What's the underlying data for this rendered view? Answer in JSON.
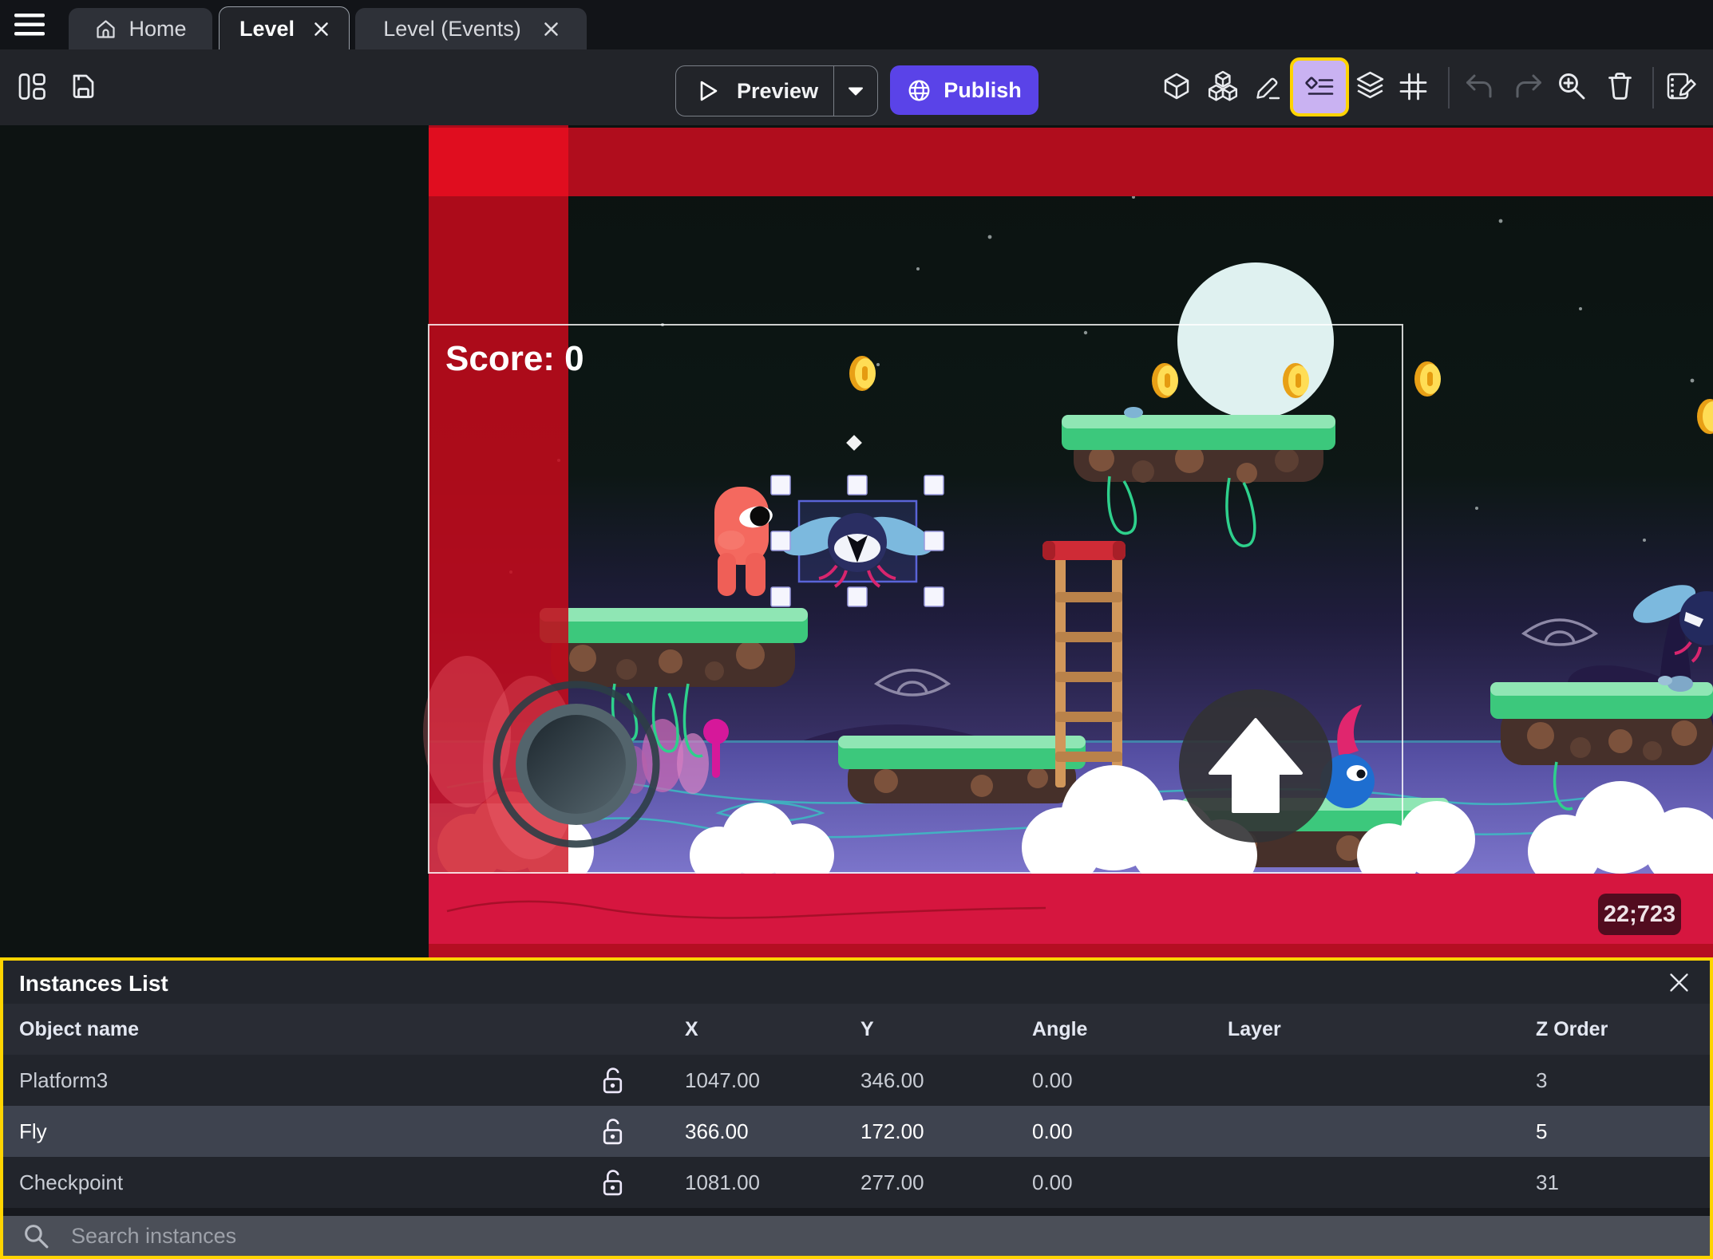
{
  "tabs": {
    "home_label": "Home",
    "level_label": "Level",
    "level_events_label": "Level (Events)"
  },
  "toolbar": {
    "preview_label": "Preview",
    "publish_label": "Publish",
    "right_icons": [
      "objects",
      "object-groups",
      "edit",
      "instances-list",
      "layers",
      "grid",
      "undo",
      "redo",
      "zoom-in",
      "delete",
      "edit-scene-events"
    ],
    "highlighted_icon": "instances-list"
  },
  "canvas": {
    "score_label": "Score: 0",
    "coords_badge": "22;723",
    "selected_instance": "Fly"
  },
  "panel": {
    "title": "Instances List",
    "columns": [
      "Object name",
      "X",
      "Y",
      "Angle",
      "Layer",
      "Z Order"
    ],
    "rows": [
      {
        "name": "Platform3",
        "x": "1047.00",
        "y": "346.00",
        "angle": "0.00",
        "layer": "",
        "z": "3"
      },
      {
        "name": "Fly",
        "x": "366.00",
        "y": "172.00",
        "angle": "0.00",
        "layer": "",
        "z": "5"
      },
      {
        "name": "Checkpoint",
        "x": "1081.00",
        "y": "277.00",
        "angle": "0.00",
        "layer": "",
        "z": "31"
      }
    ],
    "search_placeholder": "Search instances"
  },
  "colors": {
    "accent_purple": "#5a43e8",
    "highlight_yellow": "#ffd400",
    "selected_row": "#3e434f",
    "scene_red_band": "#b30d1d",
    "scene_crimson": "#d6163f",
    "panel_bg": "#22252c"
  }
}
